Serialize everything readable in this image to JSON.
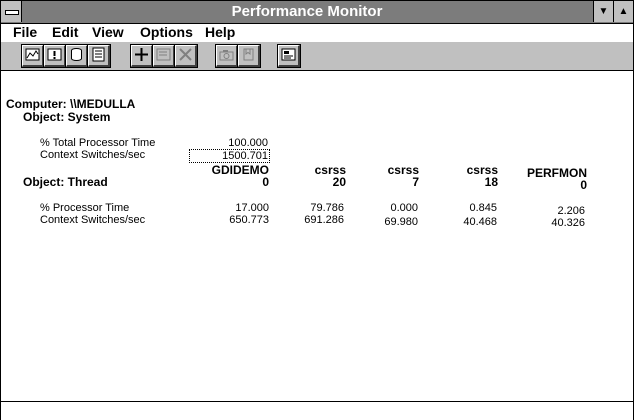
{
  "window": {
    "title": "Performance Monitor"
  },
  "menu": {
    "file": "File",
    "edit": "Edit",
    "view": "View",
    "options": "Options",
    "help": "Help"
  },
  "icons": {
    "chart": "chart-view-icon",
    "alert": "alert-view-icon",
    "log": "log-view-icon",
    "report": "report-view-icon",
    "add": "add-counter-icon",
    "edit": "edit-counter-icon",
    "delete": "delete-counter-icon",
    "update": "update-now-icon",
    "bookmark": "bookmark-icon",
    "options": "options-icon"
  },
  "report": {
    "computer_label": "Computer: \\\\MEDULLA",
    "object_system": "Object: System",
    "sys_counter_1": "% Total Processor Time",
    "sys_value_1": "100.000",
    "sys_counter_2": "Context Switches/sec",
    "sys_value_2": "1500.701",
    "object_thread": "Object: Thread",
    "thread_counter_1": "% Processor Time",
    "thread_counter_2": "Context Switches/sec",
    "columns": [
      {
        "name": "GDIDEMO",
        "instance": "0",
        "v1": "17.000",
        "v2": "650.773"
      },
      {
        "name": "csrss",
        "instance": "20",
        "v1": "79.786",
        "v2": "691.286"
      },
      {
        "name": "csrss",
        "instance": "7",
        "v1": "0.000",
        "v2": "69.980"
      },
      {
        "name": "csrss",
        "instance": "18",
        "v1": "0.845",
        "v2": "40.468"
      },
      {
        "name": "PERFMON",
        "instance": "0",
        "v1": "2.206",
        "v2": "40.326"
      }
    ]
  }
}
